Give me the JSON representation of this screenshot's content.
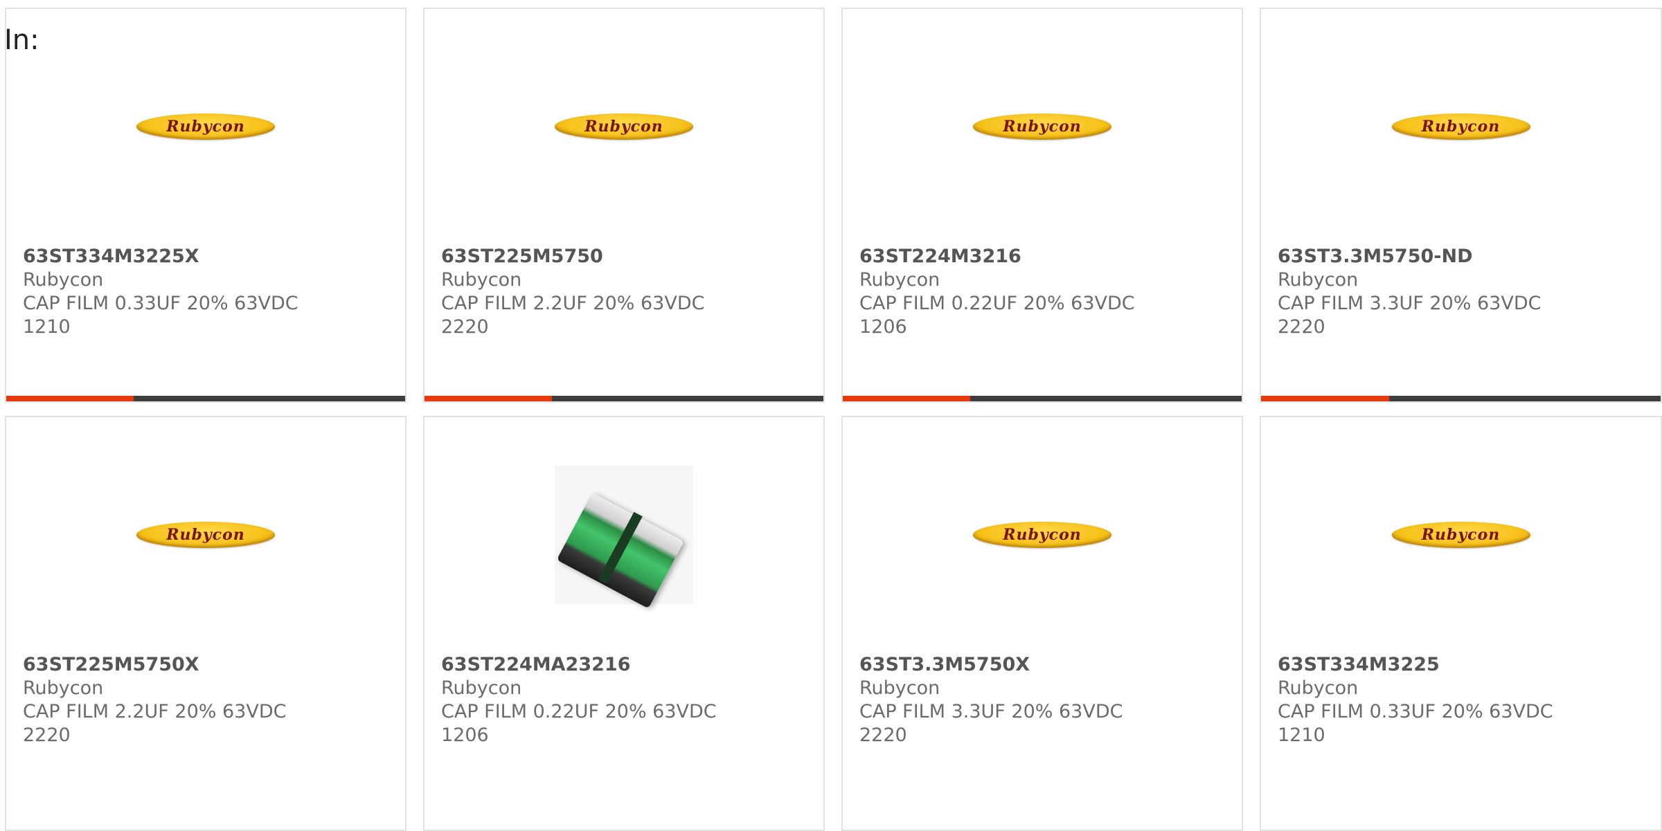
{
  "heading": "In:",
  "colors": {
    "accent": "#e8390e",
    "bar_track": "#3d3d3d",
    "card_border": "#e2e2e2",
    "text": "#6b6b6b"
  },
  "products": [
    {
      "part_number": "63ST334M3225X",
      "manufacturer": "Rubycon",
      "description": "CAP FILM 0.33UF 20% 63VDC",
      "package": "1210",
      "image": "rubycon-logo",
      "logo_text": "Rubycon",
      "progress": 0.32
    },
    {
      "part_number": "63ST225M5750",
      "manufacturer": "Rubycon",
      "description": "CAP FILM 2.2UF 20% 63VDC",
      "package": "2220",
      "image": "rubycon-logo",
      "logo_text": "Rubycon",
      "progress": 0.32
    },
    {
      "part_number": "63ST224M3216",
      "manufacturer": "Rubycon",
      "description": "CAP FILM 0.22UF 20% 63VDC",
      "package": "1206",
      "image": "rubycon-logo",
      "logo_text": "Rubycon",
      "progress": 0.32
    },
    {
      "part_number": "63ST3.3M5750-ND",
      "manufacturer": "Rubycon",
      "description": "CAP FILM 3.3UF 20% 63VDC",
      "package": "2220",
      "image": "rubycon-logo",
      "logo_text": "Rubycon",
      "progress": 0.32
    },
    {
      "part_number": "63ST225M5750X",
      "manufacturer": "Rubycon",
      "description": "CAP FILM 2.2UF 20% 63VDC",
      "package": "2220",
      "image": "rubycon-logo",
      "logo_text": "Rubycon"
    },
    {
      "part_number": "63ST224MA23216",
      "manufacturer": "Rubycon",
      "description": "CAP FILM 0.22UF 20% 63VDC",
      "package": "1206",
      "image": "smd-capacitor-photo"
    },
    {
      "part_number": "63ST3.3M5750X",
      "manufacturer": "Rubycon",
      "description": "CAP FILM 3.3UF 20% 63VDC",
      "package": "2220",
      "image": "rubycon-logo",
      "logo_text": "Rubycon"
    },
    {
      "part_number": "63ST334M3225",
      "manufacturer": "Rubycon",
      "description": "CAP FILM 0.33UF 20% 63VDC",
      "package": "1210",
      "image": "rubycon-logo",
      "logo_text": "Rubycon"
    }
  ]
}
